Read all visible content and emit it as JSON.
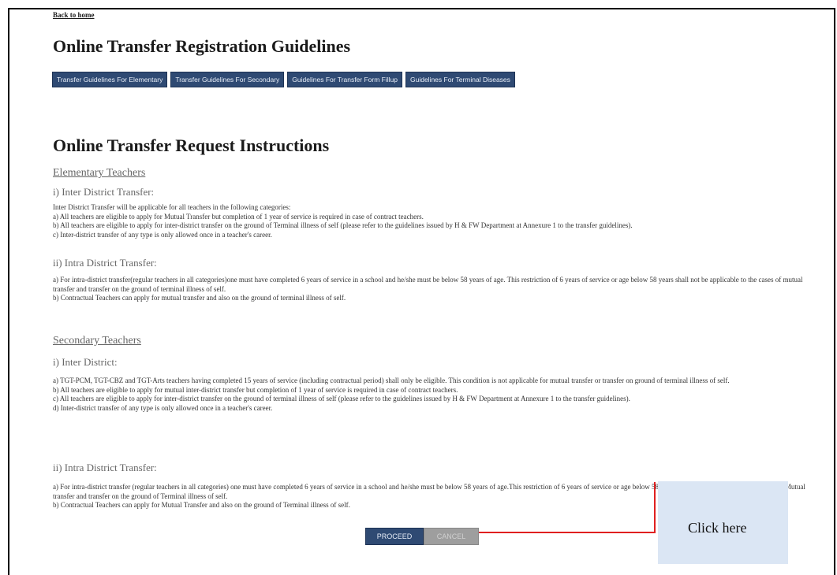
{
  "header": {
    "back_link": "Back to home",
    "guidelines_title": "Online Transfer Registration Guidelines"
  },
  "tabs": [
    {
      "label": "Transfer Guidelines For Elementary"
    },
    {
      "label": "Transfer Guidelines For Secondary"
    },
    {
      "label": "Guidelines For Transfer Form Fillup"
    },
    {
      "label": "Guidelines For Terminal Diseases"
    }
  ],
  "instructions": {
    "title": "Online Transfer Request Instructions",
    "elementary": {
      "heading": "Elementary Teachers",
      "inter_heading": "i) Inter District Transfer:",
      "inter_lines": [
        "Inter District Transfer will be applicable for all teachers in the following categories:",
        "a) All teachers are eligible to apply for Mutual Transfer but completion of 1 year of service is required in case of contract teachers.",
        "b) All teachers are eligible to apply for inter-district transfer on the ground of Terminal illness of self (please refer to the guidelines issued by H & FW Department at Annexure 1 to the transfer guidelines).",
        "c) Inter-district transfer of any type is only allowed once in a teacher's career."
      ],
      "intra_heading": "ii) Intra District Transfer:",
      "intra_lines": [
        "a) For intra-district transfer(regular teachers in all categories)one must have completed 6 years of service in a school and he/she must be below 58 years of age. This restriction of 6 years of service or age below 58 years shall not be applicable to the cases of mutual transfer and transfer on the ground of terminal illness of self.",
        "b) Contractual Teachers can apply for mutual transfer and also on the ground of terminal illness of self."
      ]
    },
    "secondary": {
      "heading": "Secondary Teachers",
      "inter_heading": "i) Inter District:",
      "inter_lines": [
        "a) TGT-PCM, TGT-CBZ and TGT-Arts teachers having completed 15 years of service (including contractual period) shall only be eligible. This condition is not applicable for mutual transfer or transfer on ground of terminal illness of self.",
        "b) All teachers are eligible to apply for mutual inter-district transfer but completion of 1 year of service is required in case of contract teachers.",
        "c) All teachers are eligible to apply for inter-district transfer on the ground of terminal illness of self (please refer to the guidelines issued by H & FW Department at Annexure 1 to the transfer guidelines).",
        "d) Inter-district transfer of any type is only allowed once in a teacher's career."
      ],
      "intra_heading": "ii) Intra District Transfer:",
      "intra_lines": [
        "a) For intra-district transfer (regular teachers in all categories) one must have completed 6 years of service in a school and he/she must be below 58 years of age.This restriction of 6 years of service or age below 58 years shall not be applicable to the cases of Mutual transfer and transfer on the ground of Terminal illness of self.",
        "b) Contractual Teachers can apply for Mutual Transfer and also on the ground of Terminal illness of self."
      ]
    }
  },
  "actions": {
    "proceed_label": "PROCEED",
    "cancel_label": "CANCEL"
  },
  "annotation": {
    "callout_text": "Click here",
    "arrow_color": "#e02020",
    "callout_bg": "#dbe6f4"
  },
  "colors": {
    "tab_bg": "#2f4a73",
    "tab_text": "#e8eef8"
  }
}
